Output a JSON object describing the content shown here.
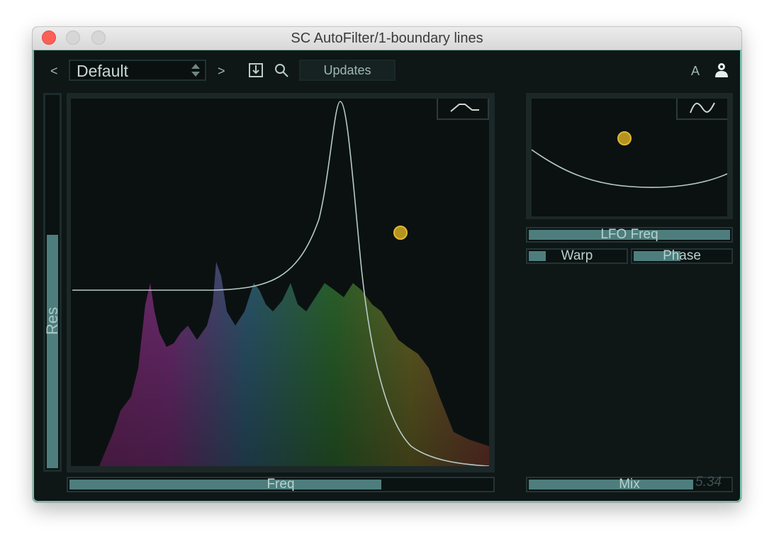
{
  "window": {
    "title": "SC AutoFilter/1-boundary lines"
  },
  "toolbar": {
    "prev_label": "<",
    "next_label": ">",
    "preset_name": "Default",
    "updates_label": "Updates",
    "a_label": "A",
    "save_icon": "save-icon",
    "search_icon": "search-icon",
    "user_icon": "user-icon"
  },
  "controls": {
    "res": {
      "label": "Res",
      "value": 0.63
    },
    "freq": {
      "label": "Freq",
      "value": 0.74
    },
    "lfo_freq": {
      "label": "LFO Freq",
      "value": 1.0
    },
    "warp": {
      "label": "Warp",
      "value": 0.2
    },
    "phase": {
      "label": "Phase",
      "value": 0.5
    },
    "mix": {
      "label": "Mix",
      "value": 0.82
    }
  },
  "filter_shape_icon": "lowpass-shape-icon",
  "lfo_shape_icon": "sine-wave-icon",
  "version": "5.34",
  "colors": {
    "accent": "#6fc3a6",
    "slider_fill": "#4d7e7d",
    "handle": "#e0b836"
  }
}
